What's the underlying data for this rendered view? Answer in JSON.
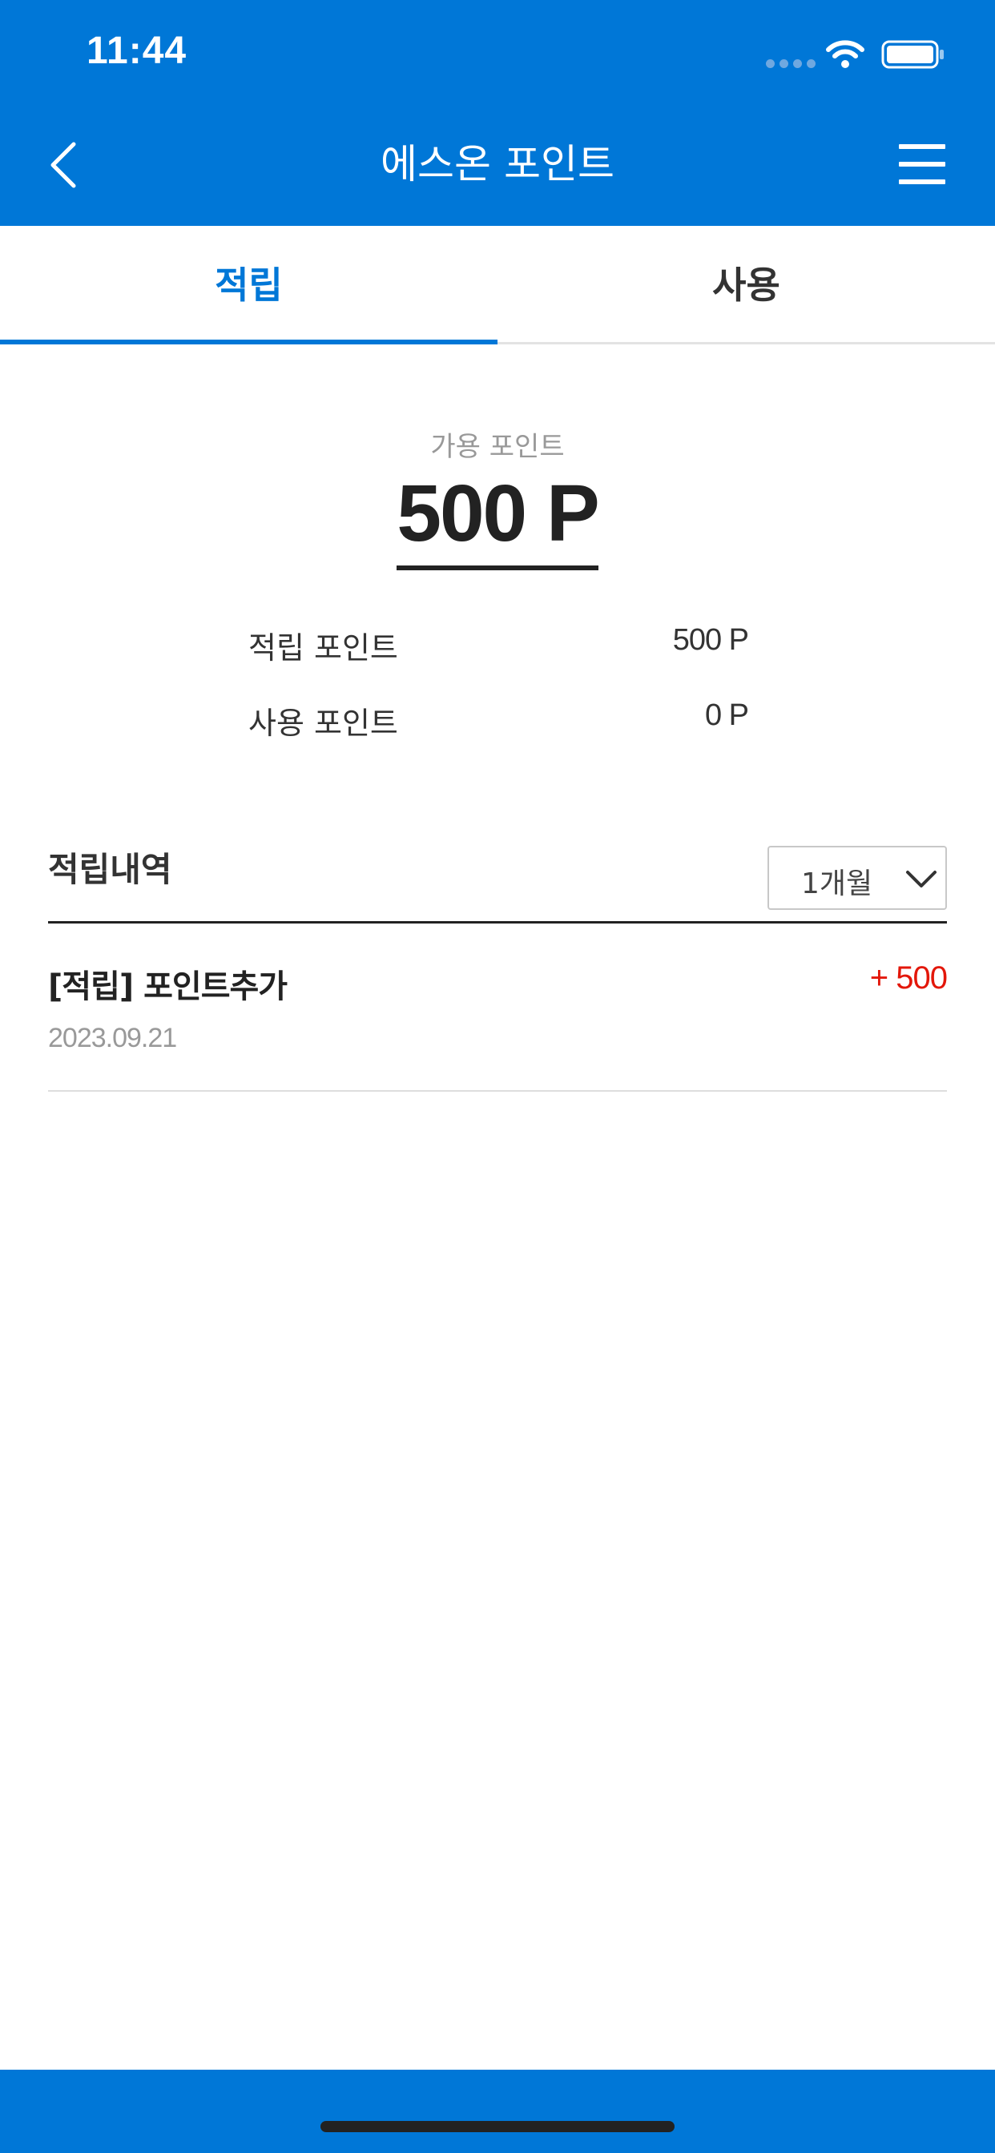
{
  "status_bar": {
    "time": "11:44"
  },
  "nav": {
    "title": "에스온 포인트"
  },
  "tabs": [
    {
      "label": "적립",
      "active": true
    },
    {
      "label": "사용",
      "active": false
    }
  ],
  "summary": {
    "available_label": "가용 포인트",
    "available_value": "500 P",
    "rows": [
      {
        "label": "적립 포인트",
        "value": "500 P"
      },
      {
        "label": "사용 포인트",
        "value": "0 P"
      }
    ]
  },
  "history": {
    "title": "적립내역",
    "period": "1개월",
    "items": [
      {
        "title": "[적립] 포인트추가",
        "date": "2023.09.21",
        "amount": "+ 500"
      }
    ]
  },
  "colors": {
    "brand": "#0077d7",
    "amount_positive": "#e3170a",
    "text_dark": "#222222",
    "text_muted": "#999999"
  },
  "icons": {
    "back": "chevron-left-icon",
    "menu": "hamburger-menu-icon",
    "wifi": "wifi-icon",
    "battery": "battery-icon",
    "dropdown": "chevron-down-icon"
  }
}
